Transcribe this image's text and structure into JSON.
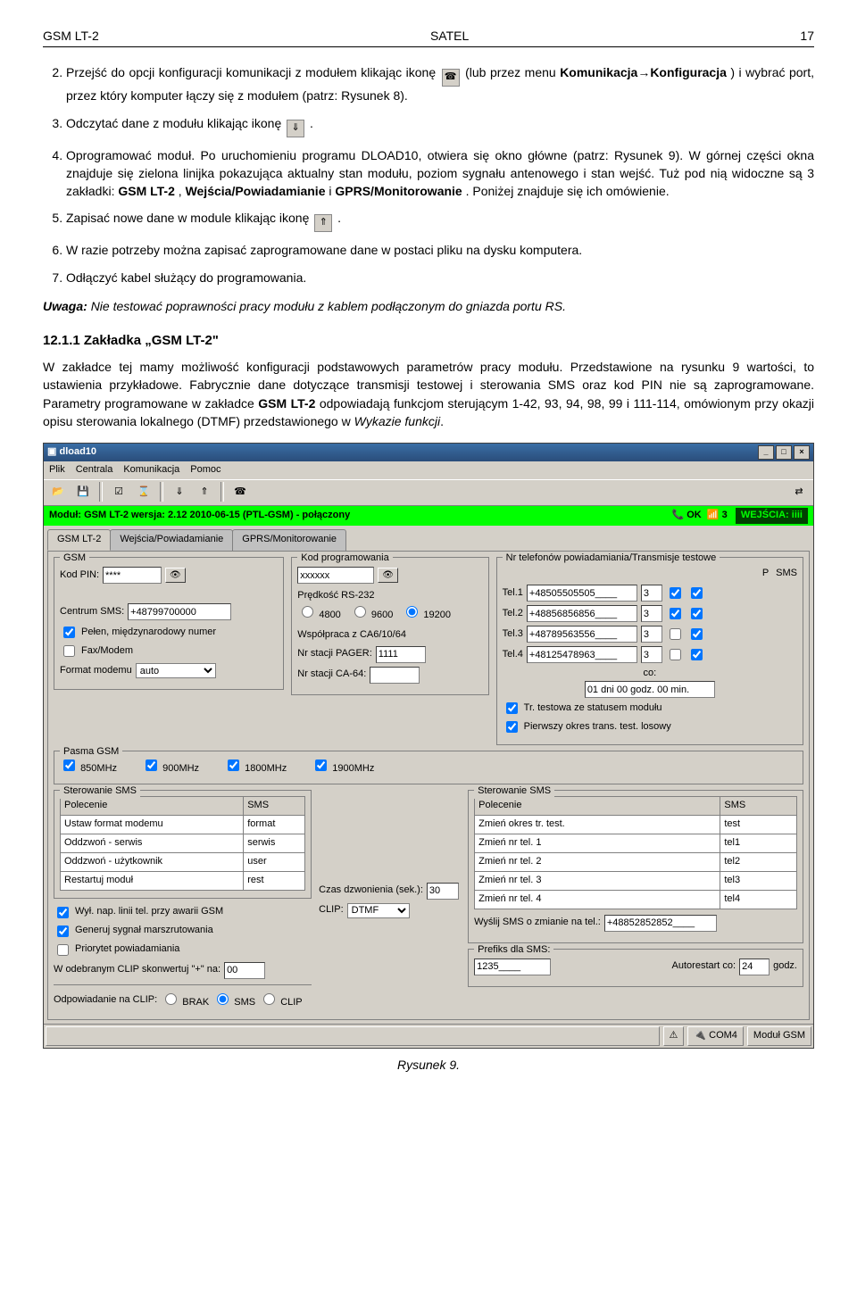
{
  "header": {
    "left": "GSM LT-2",
    "center": "SATEL",
    "right": "17"
  },
  "list": {
    "item2a": "Przejść do opcji konfiguracji komunikacji z modułem klikając ikonę ",
    "item2b": " (lub przez menu ",
    "item2menu": "Komunikacja→Konfiguracja",
    "item2c": ") i wybrać port, przez który komputer łączy się z modułem (patrz: Rysunek 8).",
    "item3": "Odczytać dane z modułu klikając ikonę ",
    "item3b": ".",
    "item4": "Oprogramować moduł. Po uruchomieniu programu DLOAD10, otwiera się okno główne (patrz: Rysunek 9). W górnej części okna znajduje się zielona linijka pokazująca aktualny stan modułu, poziom sygnału antenowego i stan wejść. Tuż pod nią widoczne są 3 zakładki: ",
    "item4tabs": "GSM LT-2",
    "item4tabs2": ", ",
    "item4tabs3": "Wejścia/Powiadamianie",
    "item4tabs4": " i ",
    "item4tabs5": "GPRS/Monitorowanie",
    "item4end": ". Poniżej znajduje się ich omówienie.",
    "item5": "Zapisać nowe dane w module klikając ikonę ",
    "item5b": ".",
    "item6": "W razie potrzeby można zapisać zaprogramowane dane w postaci pliku na dysku komputera.",
    "item7": "Odłączyć kabel służący do programowania."
  },
  "note": {
    "prefix": "Uwaga:",
    "text": " Nie testować poprawności pracy modułu z kablem podłączonym do gniazda portu RS."
  },
  "section": {
    "heading": "12.1.1  Zakładka „GSM LT-2\"",
    "paragraph": "W zakładce tej mamy możliwość konfiguracji podstawowych parametrów pracy modułu. Przedstawione na rysunku 9 wartości, to ustawienia przykładowe. Fabrycznie dane dotyczące transmisji testowej i sterowania SMS oraz kod PIN nie są zaprogramowane. Parametry programowane w zakładce GSM LT-2 odpowiadają funkcjom sterującym 1-42, 93, 94, 98, 99 i 111-114, omówionym przy okazji opisu sterowania lokalnego (DTMF) przedstawionego w Wykazie funkcji.",
    "boldinline": "GSM LT-2",
    "italinline": "Wykazie funkcji"
  },
  "app": {
    "title": "dload10",
    "menu": [
      "Plik",
      "Centrala",
      "Komunikacja",
      "Pomoc"
    ],
    "status_line": "Moduł: GSM LT-2 wersja: 2.12 2010-06-15 (PTL-GSM) - połączony",
    "status_ok": "OK",
    "status_signal": "3",
    "status_wejscia": "WEJŚCIA:",
    "status_wejscia_val": "iiii",
    "tabs": [
      "GSM LT-2",
      "Wejścia/Powiadamianie",
      "GPRS/Monitorowanie"
    ],
    "gsm_group": "GSM",
    "kod_pin_label": "Kod PIN:",
    "kod_pin": "****",
    "centrum_sms_label": "Centrum SMS:",
    "centrum_sms": "+48799700000",
    "pelen_chk": "Pełen, międzynarodowy numer",
    "fax_chk": "Fax/Modem",
    "format_modemu_label": "Format modemu",
    "format_modemu": "auto",
    "kod_prog_group": "Kod programowania",
    "kod_prog": "xxxxxx",
    "predkosc_label": "Prędkość RS-232",
    "radio_4800": "4800",
    "radio_9600": "9600",
    "radio_19200": "19200",
    "wspolpraca_label": "Współpraca z CA6/10/64",
    "pager_label": "Nr stacji PAGER:",
    "pager": "1111",
    "ca64_label": "Nr stacji CA-64:",
    "pasma_group": "Pasma GSM",
    "band850": "850MHz",
    "band900": "900MHz",
    "band1800": "1800MHz",
    "band1900": "1900MHz",
    "ster1_group": "Sterowanie SMS",
    "ster1_cols": [
      "Polecenie",
      "SMS"
    ],
    "ster1_rows": [
      [
        "Ustaw format modemu",
        "format"
      ],
      [
        "Oddzwoń - serwis",
        "serwis"
      ],
      [
        "Oddzwoń - użytkownik",
        "user"
      ],
      [
        "Restartuj moduł",
        "rest"
      ]
    ],
    "chk_wyl": "Wył. nap. linii tel. przy awarii GSM",
    "chk_generuj": "Generuj sygnał marszrutowania",
    "chk_priorytet": "Priorytet powiadamiania",
    "clip_konw_label": "W odebranym CLIP skonwertuj \"+\" na:",
    "clip_konw": "00",
    "czas_dzw_label": "Czas dzwonienia   (sek.):",
    "czas_dzw": "30",
    "clip_label": "CLIP:",
    "clip_val": "DTMF",
    "odp_clip_label": "Odpowiadanie na CLIP:",
    "odp_brak": "BRAK",
    "odp_sms": "SMS",
    "odp_clip": "CLIP",
    "nrtel_group": "Nr telefonów powiadamiania/Transmisje testowe",
    "tel_labels": [
      "Tel.1",
      "Tel.2",
      "Tel.3",
      "Tel.4"
    ],
    "tel_vals": [
      "+48505505505____",
      "+48856856856____",
      "+48789563556____",
      "+48125478963____"
    ],
    "tel_counts": [
      "3",
      "3",
      "3",
      "3"
    ],
    "p_label": "P",
    "sms_label": "SMS",
    "co_label": "co:",
    "co_val": "01 dni 00 godz. 00 min.",
    "chk_tr_test": "Tr. testowa ze statusem modułu",
    "chk_pierwszy": "Pierwszy okres trans. test. losowy",
    "ster2_group": "Sterowanie SMS",
    "ster2_cols": [
      "Polecenie",
      "SMS"
    ],
    "ster2_rows": [
      [
        "Zmień okres tr. test.",
        "test"
      ],
      [
        "Zmień nr tel. 1",
        "tel1"
      ],
      [
        "Zmień nr tel. 2",
        "tel2"
      ],
      [
        "Zmień nr tel. 3",
        "tel3"
      ],
      [
        "Zmień nr tel. 4",
        "tel4"
      ]
    ],
    "wyslij_sms_label": "Wyślij SMS o zmianie na tel.:",
    "wyslij_sms_val": "+48852852852____",
    "prefiks_group": "Prefiks dla SMS:",
    "prefiks_val": "1235____",
    "autorestart_label": "Autorestart co:",
    "autorestart_val": "24",
    "autorestart_unit": "godz.",
    "statusbar": {
      "com": "COM4",
      "modul": "Moduł GSM"
    }
  },
  "caption": "Rysunek 9."
}
